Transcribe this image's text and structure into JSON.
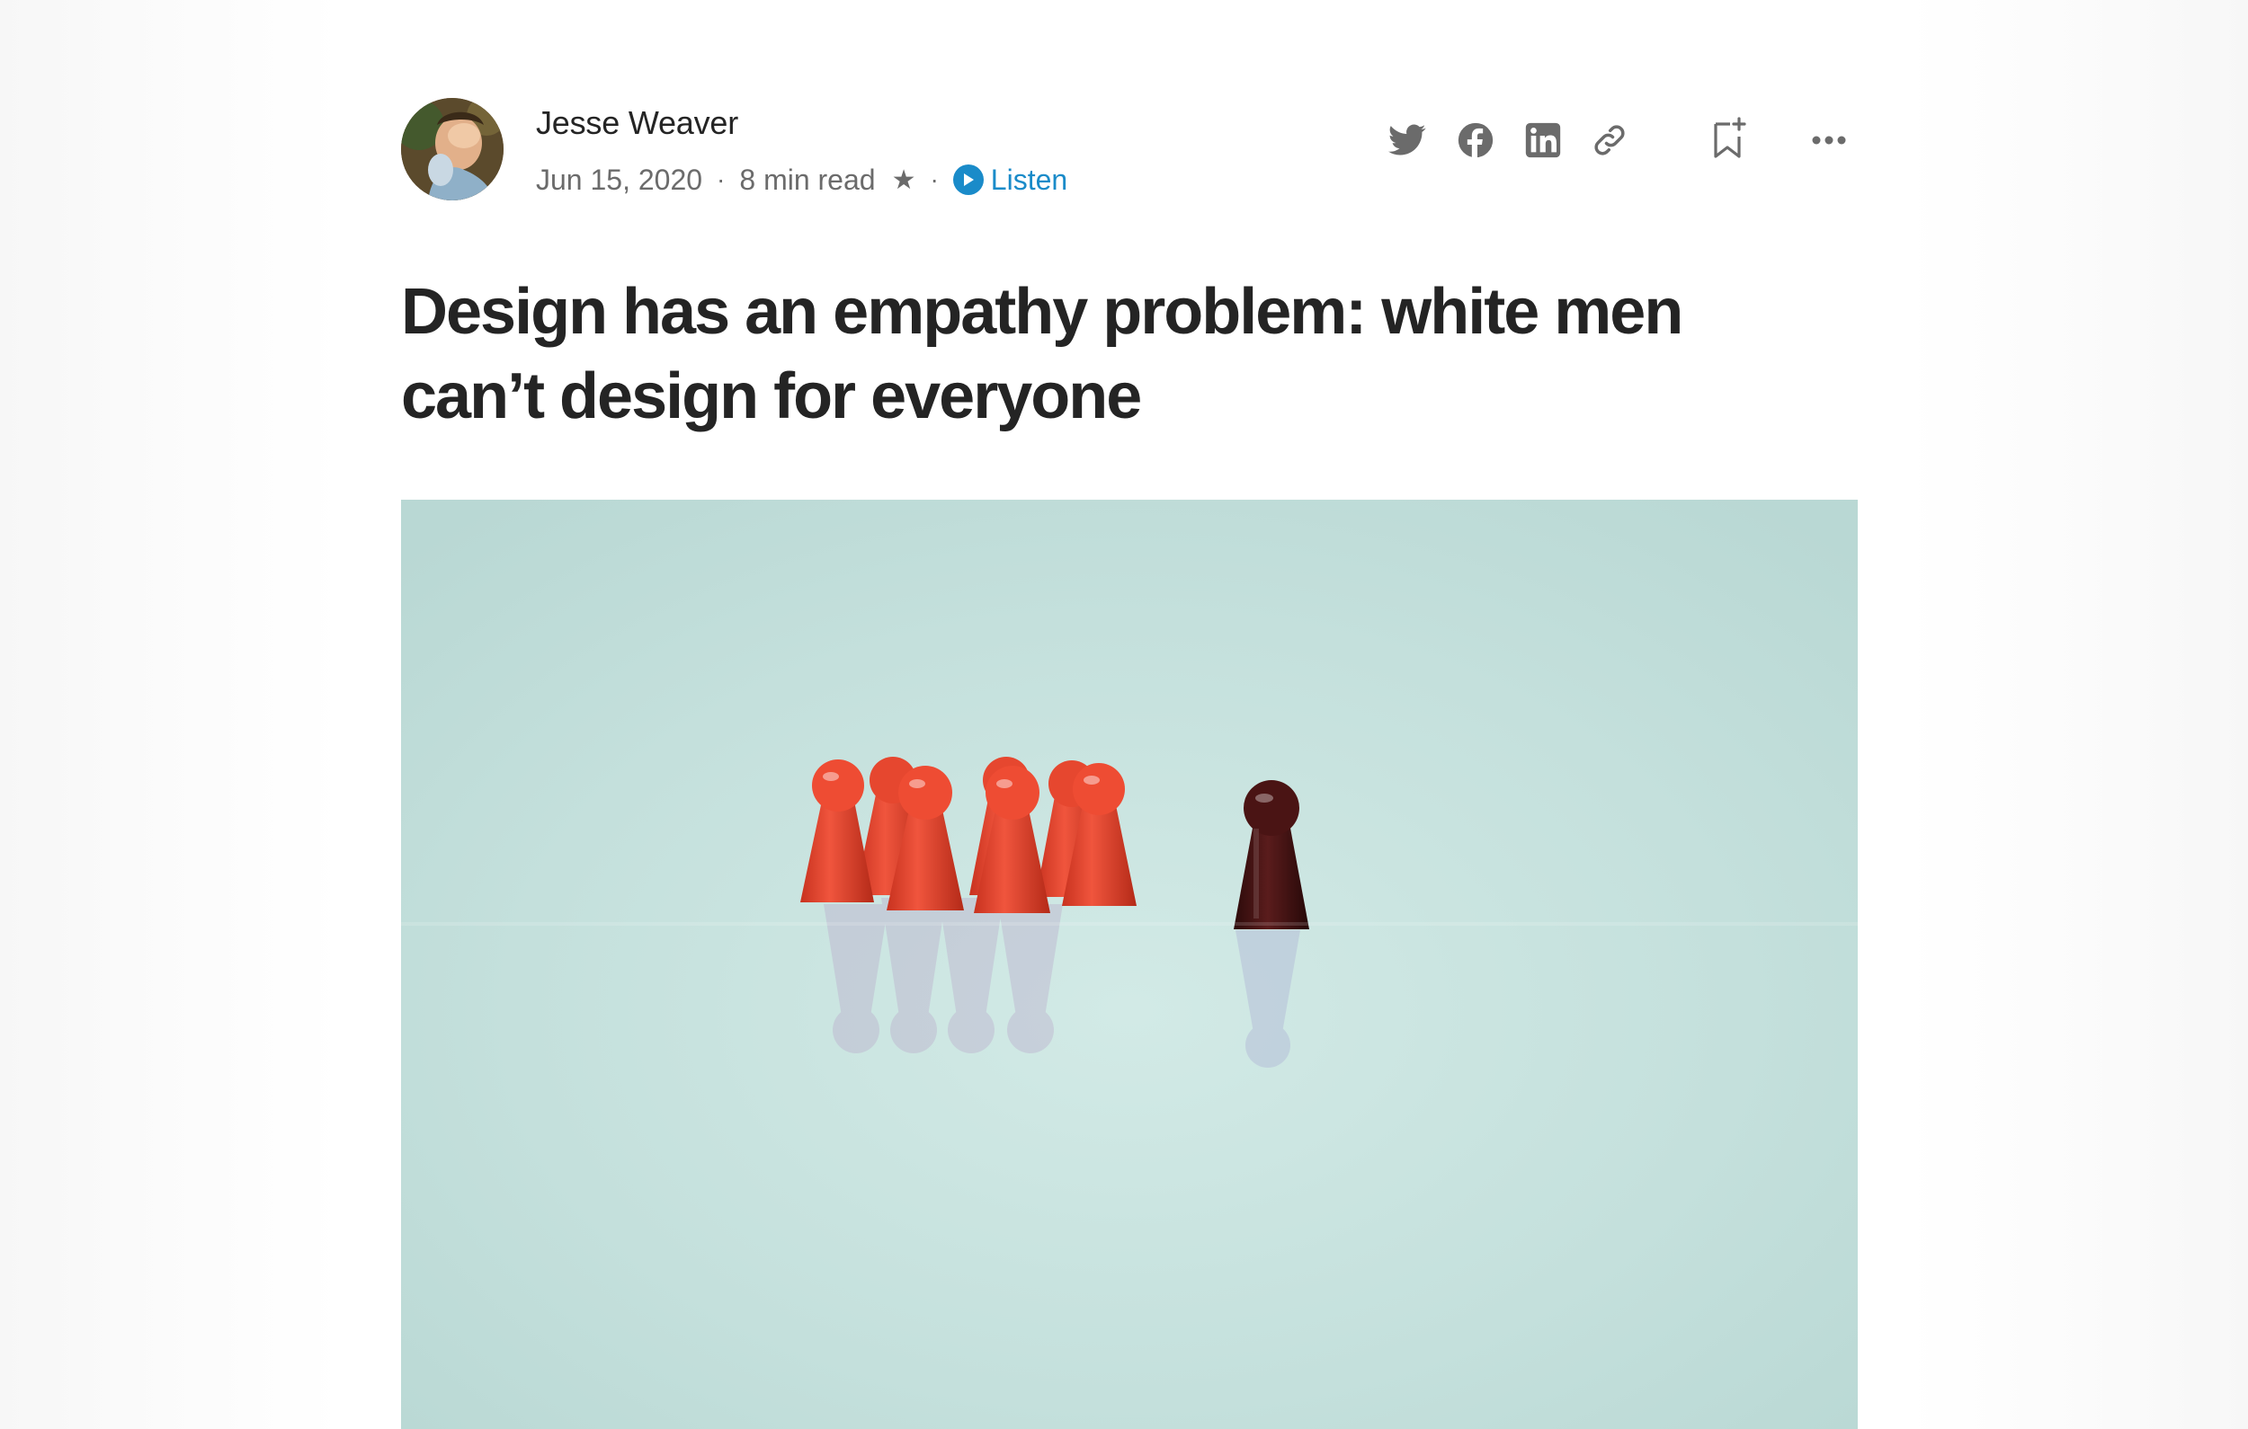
{
  "author": {
    "name": "Jesse Weaver",
    "avatar_alt": "Jesse Weaver avatar"
  },
  "meta": {
    "date": "Jun 15, 2020",
    "separator": "·",
    "read_time": "8 min read",
    "member_icon": "star-icon",
    "member_glyph": "★",
    "listen_label": "Listen",
    "listen_color": "#1a8bc9"
  },
  "actions": {
    "icons": [
      "twitter-icon",
      "facebook-icon",
      "linkedin-icon",
      "copy-link-icon",
      "bookmark-add-icon",
      "more-options-icon"
    ],
    "icon_color": "#6b6b6b"
  },
  "article": {
    "title_line1": "Design has an empathy problem: white men",
    "title_line2": "can’t design for everyone"
  },
  "hero_image": {
    "description_icon": "pawn-pieces-image",
    "background_color": "#c6e2de",
    "group_color": "#e8402a",
    "lone_color": "#4a1414"
  }
}
